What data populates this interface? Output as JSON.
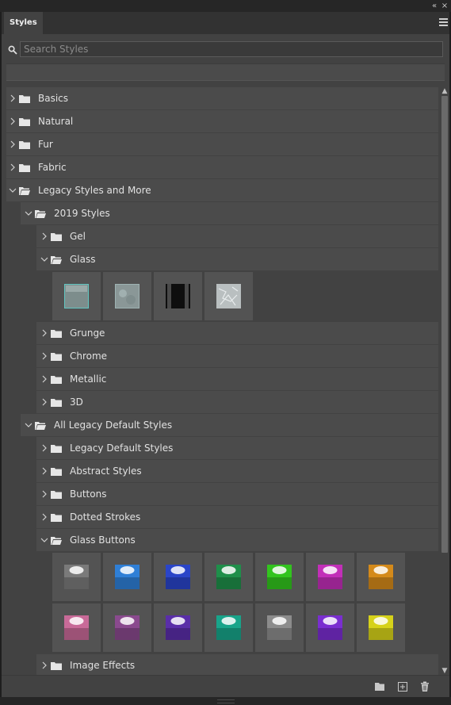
{
  "window": {
    "collapse_label": "«",
    "close_label": "×"
  },
  "panel": {
    "tab_label": "Styles",
    "menu_icon": "hamburger-icon"
  },
  "search": {
    "placeholder": "Search Styles",
    "value": ""
  },
  "tree": {
    "basics": "Basics",
    "natural": "Natural",
    "fur": "Fur",
    "fabric": "Fabric",
    "legacy": "Legacy Styles and More",
    "styles2019": "2019 Styles",
    "gel": "Gel",
    "glass": "Glass",
    "grunge": "Grunge",
    "chrome": "Chrome",
    "metallic": "Metallic",
    "three_d": "3D",
    "all_legacy": "All Legacy Default Styles",
    "legacy_default": "Legacy Default Styles",
    "abstract": "Abstract Styles",
    "buttons": "Buttons",
    "dotted": "Dotted Strokes",
    "glass_buttons": "Glass Buttons",
    "image_effects": "Image Effects"
  },
  "glass_swatches": [
    "frosted-teal",
    "frosted-grey",
    "dark-glass",
    "crinkled-glass"
  ],
  "glass_button_colors": [
    "#7a7a7a",
    "#2f7fd6",
    "#2a45c8",
    "#1f8f4a",
    "#32c41e",
    "#c22fb8",
    "#d48a1a",
    "#c86a98",
    "#8a4a8e",
    "#5a2ea8",
    "#18a48a",
    "#8c8c8c",
    "#7a2ed0",
    "#d6d21a"
  ],
  "footer": {
    "new_group_icon": "folder-icon",
    "new_style_icon": "add-style-icon",
    "delete_icon": "trash-icon"
  },
  "colors": {
    "panel_bg": "#424242",
    "row_bg": "#4b4b4b",
    "thumb_bg": "#535353"
  }
}
